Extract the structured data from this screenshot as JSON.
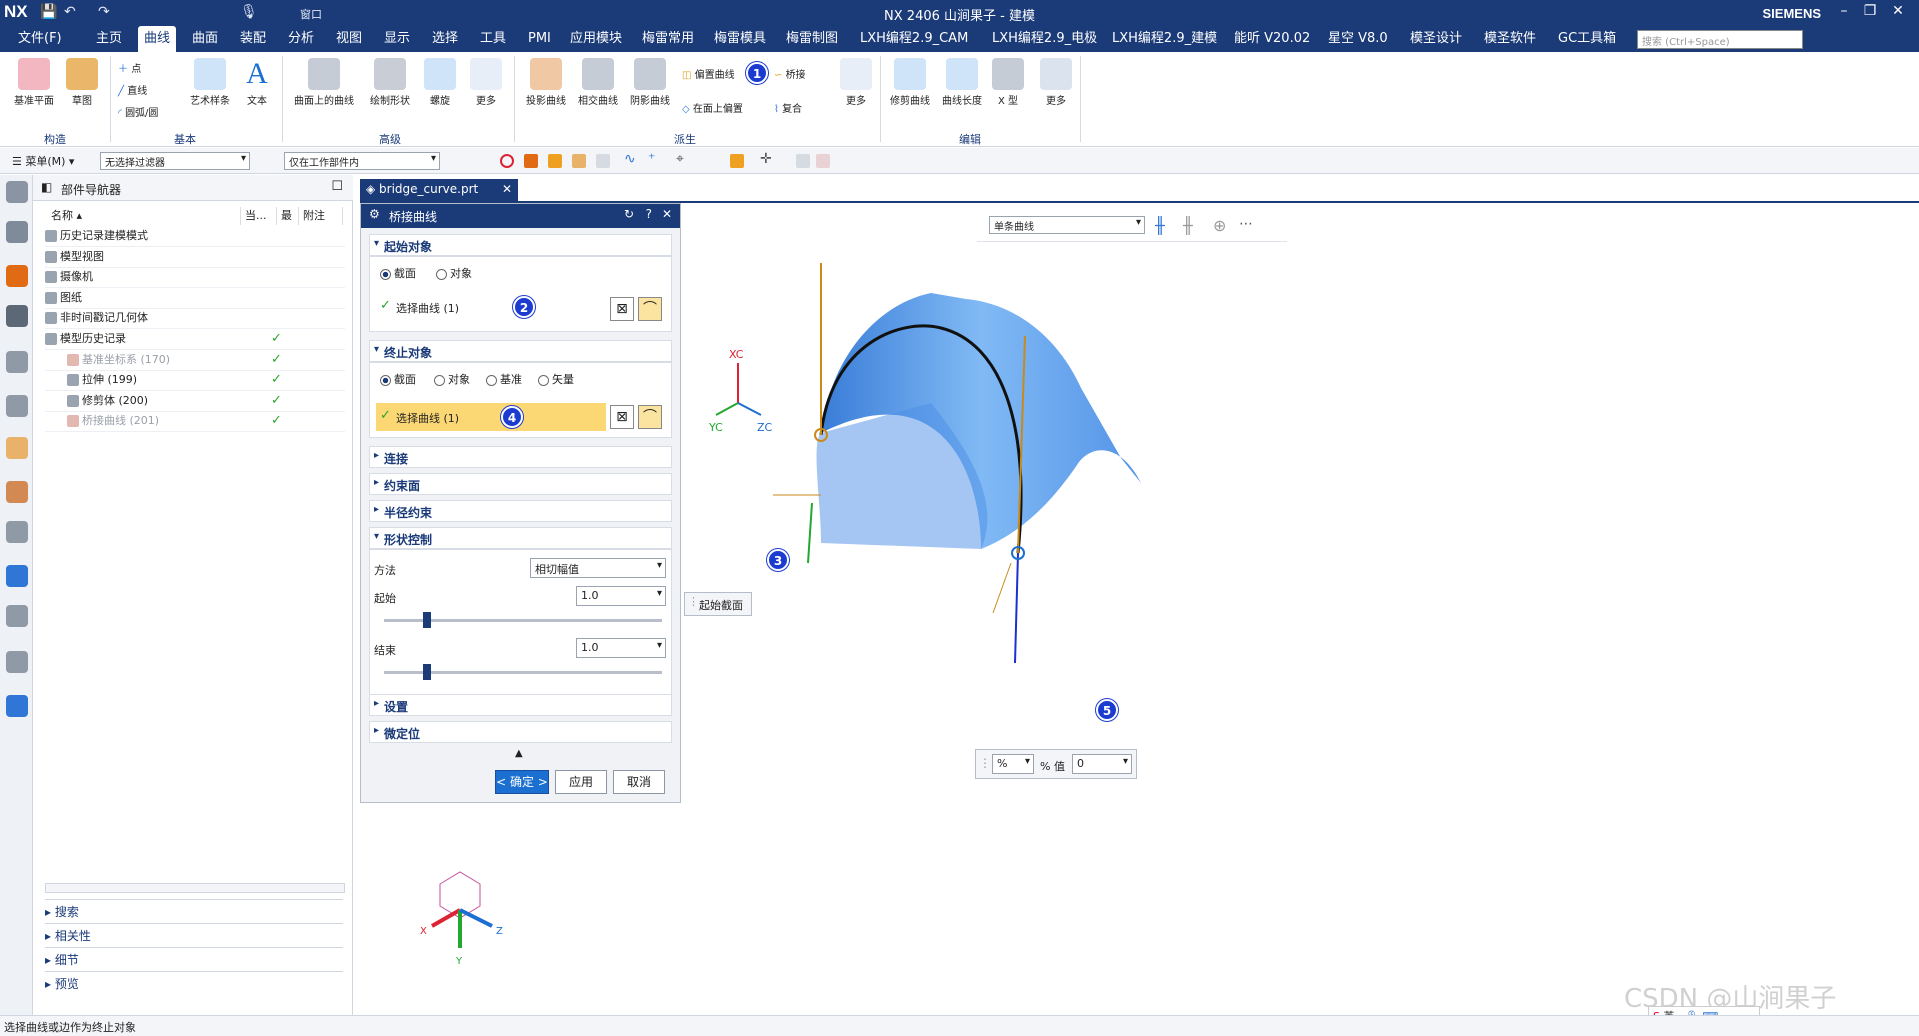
{
  "window": {
    "app": "NX",
    "title": "NX 2406 山涧果子 - 建模",
    "brand": "SIEMENS"
  },
  "quick_access": {
    "window_menu": "窗口"
  },
  "menu": {
    "file": "文件(F)",
    "tabs": [
      "主页",
      "曲线",
      "曲面",
      "装配",
      "分析",
      "视图",
      "显示",
      "选择",
      "工具",
      "PMI",
      "应用模块",
      "梅雷常用",
      "梅雷模具",
      "梅雷制图",
      "LXH编程2.9_CAM",
      "LXH编程2.9_电极",
      "LXH编程2.9_建模",
      "能听 V20.02",
      "星空 V8.0",
      "模圣设计",
      "模圣软件",
      "GC工具箱"
    ],
    "active_tab": "曲线",
    "search_placeholder": "搜索 (Ctrl+Space)"
  },
  "ribbon": {
    "construct": {
      "datum_plane": "基准平面",
      "sketch": "草图",
      "group": "构造"
    },
    "basic": {
      "point": "点",
      "line": "直线",
      "arc": "圆弧/圆",
      "art_spline": "艺术样条",
      "text": "文本",
      "group": "基本"
    },
    "advanced": {
      "curve_on_surface": "曲面上的曲线",
      "draw_shape": "绘制形状",
      "helix": "螺旋",
      "more": "更多",
      "group": "高级"
    },
    "derived": {
      "project_curve": "投影曲线",
      "intersect_curve": "相交曲线",
      "shadow_curve": "阴影曲线",
      "offset_curve": "偏置曲线",
      "offset_in_face": "在面上偏置",
      "bridge": "桥接",
      "composite": "复合",
      "more": "更多",
      "group": "派生"
    },
    "edit": {
      "trim_curve": "修剪曲线",
      "curve_length": "曲线长度",
      "x_type": "X 型",
      "more": "更多",
      "group": "编辑"
    }
  },
  "toolbar": {
    "menu": "菜单(M)",
    "filter": "无选择过滤器",
    "scope": "仅在工作部件内"
  },
  "navigator": {
    "title": "部件导航器",
    "columns": [
      "名称",
      "当...",
      "最",
      "附注"
    ],
    "rows": [
      {
        "label": "历史记录建模模式",
        "indent": 1,
        "check": false,
        "dim": false
      },
      {
        "label": "模型视图",
        "indent": 1,
        "check": false,
        "dim": false
      },
      {
        "label": "摄像机",
        "indent": 1,
        "check": false,
        "dim": false
      },
      {
        "label": "图纸",
        "indent": 1,
        "check": false,
        "dim": false
      },
      {
        "label": "非时间戳记几何体",
        "indent": 1,
        "check": false,
        "dim": false
      },
      {
        "label": "模型历史记录",
        "indent": 1,
        "check": true,
        "dim": false
      },
      {
        "label": "基准坐标系 (170)",
        "indent": 2,
        "check": true,
        "dim": true
      },
      {
        "label": "拉伸 (199)",
        "indent": 2,
        "check": true,
        "dim": false
      },
      {
        "label": "修剪体 (200)",
        "indent": 2,
        "check": true,
        "dim": false
      },
      {
        "label": "桥接曲线 (201)",
        "indent": 2,
        "check": true,
        "dim": true
      }
    ],
    "panels": [
      "搜索",
      "相关性",
      "细节",
      "预览"
    ]
  },
  "doc_tab": {
    "name": "bridge_curve.prt"
  },
  "dialog": {
    "title": "桥接曲线",
    "start": {
      "header": "起始对象",
      "opt_section": "截面",
      "opt_object": "对象",
      "select": "选择曲线 (1)"
    },
    "end": {
      "header": "终止对象",
      "opt_section": "截面",
      "opt_object": "对象",
      "opt_datum": "基准",
      "opt_vector": "矢量",
      "select": "选择曲线 (1)"
    },
    "connect": "连接",
    "constraint_face": "约束面",
    "radius_constraint": "半径约束",
    "shape_control": {
      "header": "形状控制",
      "method_label": "方法",
      "method_value": "相切幅值",
      "start_label": "起始",
      "start_value": "1.0",
      "start_level": 0.3,
      "end_label": "结束",
      "end_value": "1.0",
      "end_level": 0.3
    },
    "settings": "设置",
    "fine_position": "微定位",
    "ok": "< 确定 >",
    "apply": "应用",
    "cancel": "取消"
  },
  "viewport": {
    "selector": "单条曲线",
    "start_section_label": "起始截面",
    "percent_unit": "%",
    "percent_label": "% 值",
    "percent_value": "0",
    "axes": {
      "xc": "XC",
      "yc": "YC",
      "zc": "ZC"
    },
    "triad": {
      "x": "X",
      "y": "Y",
      "z": "Z"
    },
    "colors": {
      "surface": "#5ea3ee",
      "surface_dark": "#2f76d6"
    }
  },
  "badges": [
    "1",
    "2",
    "3",
    "4",
    "5"
  ],
  "status": "选择曲线或边作为终止对象",
  "watermark": "CSDN @山涧果子",
  "ime": {
    "lang": "英"
  }
}
